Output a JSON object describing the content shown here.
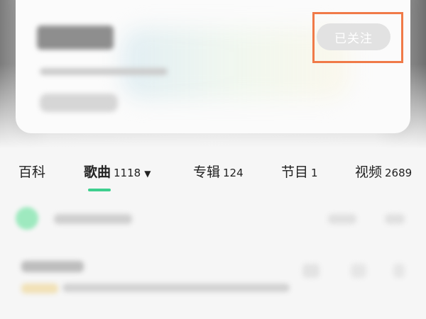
{
  "header": {
    "follow_button_label": "已关注"
  },
  "tabs": [
    {
      "label": "百科",
      "count": ""
    },
    {
      "label": "歌曲",
      "count": "1118"
    },
    {
      "label": "专辑",
      "count": "124"
    },
    {
      "label": "节目",
      "count": "1"
    },
    {
      "label": "视频",
      "count": "2689"
    }
  ],
  "active_tab_indicator": "▼",
  "colors": {
    "accent": "#3ecf8e",
    "highlight_box": "#f07a48",
    "follow_button_bg": "#e2e2e2"
  }
}
